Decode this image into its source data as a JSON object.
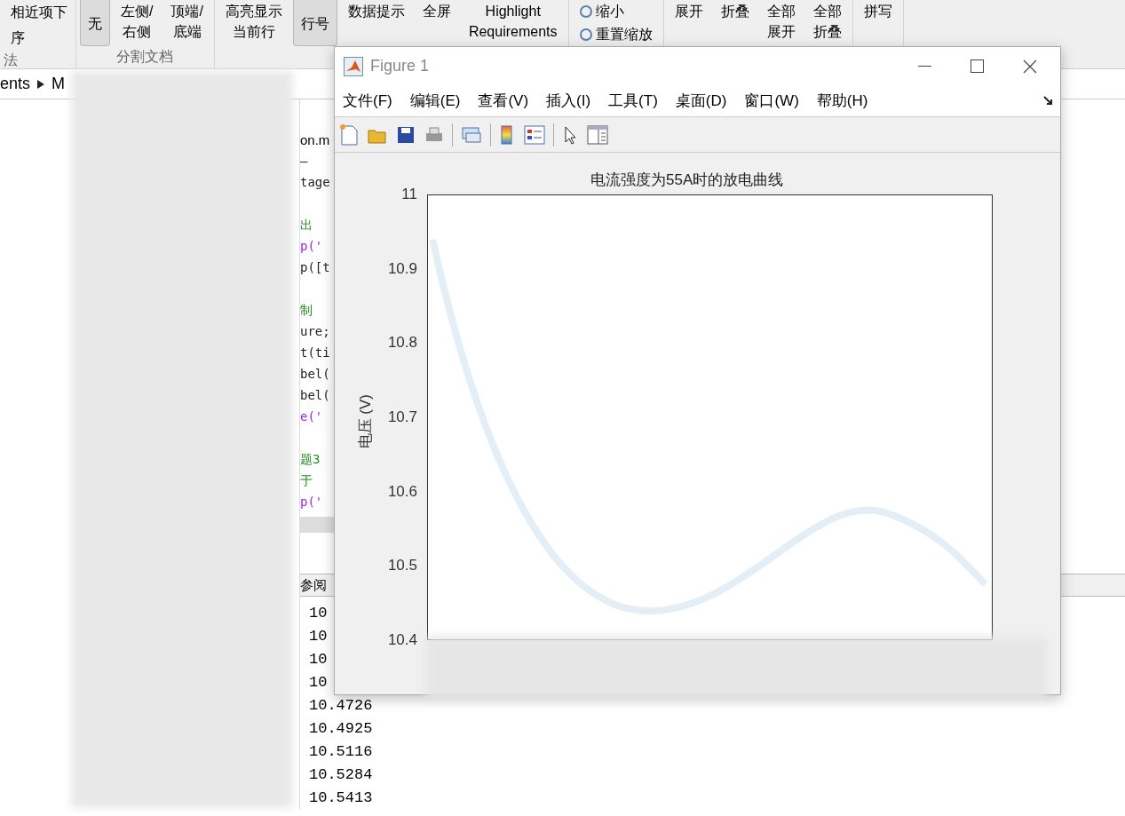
{
  "ribbon": {
    "groups": [
      {
        "items": [
          {
            "label": "相近项下",
            "selected": false
          },
          {
            "label": "序",
            "selected": false
          }
        ],
        "caption": "法"
      },
      {
        "items": [
          {
            "label": "无",
            "selected": true
          },
          {
            "label": "左侧/\n右侧",
            "selected": false
          },
          {
            "label": "顶端/\n底端",
            "selected": false
          }
        ],
        "caption": "分割文档"
      },
      {
        "items": [
          {
            "label": "高亮显示当前行",
            "selected": false
          },
          {
            "label": "行号",
            "selected": true
          },
          {
            "label": "数据提示",
            "selected": false
          },
          {
            "label": "全屏",
            "selected": false
          },
          {
            "label": "Highlight\nRequirements",
            "selected": false
          }
        ]
      },
      {
        "items": [
          {
            "label": "缩小",
            "selected": false
          },
          {
            "label": "重置缩放",
            "selected": false
          }
        ]
      },
      {
        "items": [
          {
            "label": "展开",
            "selected": false
          },
          {
            "label": "折叠",
            "selected": false
          },
          {
            "label": "全部展开",
            "selected": false
          },
          {
            "label": "全部折叠",
            "selected": false
          }
        ]
      },
      {
        "items": [
          {
            "label": "拼写",
            "selected": false
          }
        ]
      }
    ]
  },
  "breadcrumb": [
    "ents",
    "M"
  ],
  "editor": {
    "tab": "on.m",
    "lines": [
      {
        "text": "–",
        "kind": "code"
      },
      {
        "text": "tage",
        "kind": "code"
      },
      {
        "kind": "blank"
      },
      {
        "text": "出",
        "kind": "comment"
      },
      {
        "text": "p('",
        "kind": "string"
      },
      {
        "text": "p([t",
        "kind": "code"
      },
      {
        "kind": "blank"
      },
      {
        "text": "制",
        "kind": "comment"
      },
      {
        "text": "ure;",
        "kind": "code"
      },
      {
        "text": "t(ti",
        "kind": "code"
      },
      {
        "text": "bel(",
        "kind": "code"
      },
      {
        "text": "bel(",
        "kind": "code"
      },
      {
        "text": "e('",
        "kind": "string"
      },
      {
        "kind": "blank"
      },
      {
        "text": "题3",
        "kind": "comment"
      },
      {
        "text": "于",
        "kind": "comment"
      },
      {
        "text": "p('",
        "kind": "string"
      }
    ]
  },
  "command_window": {
    "header": "参阅",
    "values": [
      "10",
      "10",
      "10",
      "10",
      "10.4726",
      "10.4925",
      "10.5116",
      "10.5284",
      "10.5413"
    ]
  },
  "figure": {
    "title": "Figure 1",
    "menu": [
      "文件(F)",
      "编辑(E)",
      "查看(V)",
      "插入(I)",
      "工具(T)",
      "桌面(D)",
      "窗口(W)",
      "帮助(H)"
    ],
    "axes": {
      "title": "电流强度为55A时的放电曲线",
      "ylabel": "电压 (V)",
      "yticks": [
        "11",
        "10.9",
        "10.8",
        "10.7",
        "10.6",
        "10.5",
        "10.4"
      ]
    }
  }
}
